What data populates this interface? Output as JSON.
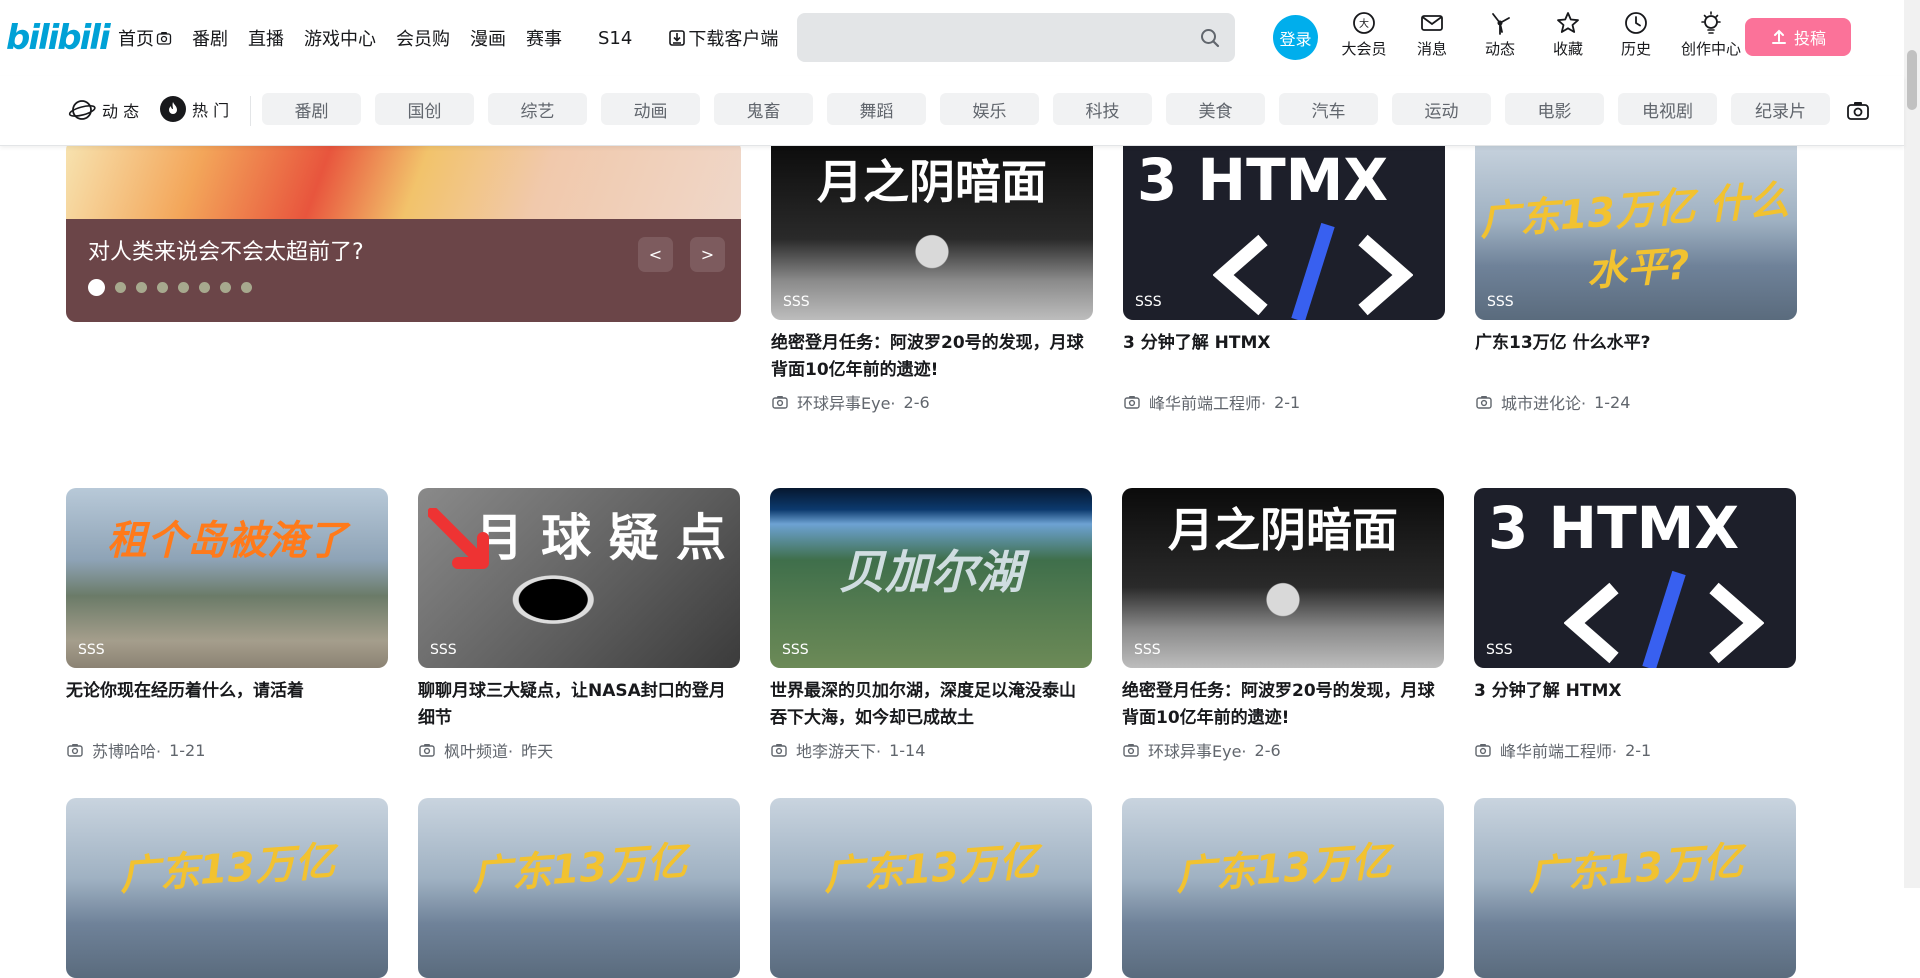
{
  "header": {
    "logo": "bilibili",
    "nav": [
      {
        "label": "首页",
        "icon": "camera-icon"
      },
      {
        "label": "番剧"
      },
      {
        "label": "直播"
      },
      {
        "label": "游戏中心"
      },
      {
        "label": "会员购"
      },
      {
        "label": "漫画"
      },
      {
        "label": "赛事"
      },
      {
        "label": "S14"
      }
    ],
    "download": "下载客户端",
    "search_placeholder": "",
    "login": "登录",
    "right_icons": [
      {
        "label": "大会员",
        "icon": "vip-icon"
      },
      {
        "label": "消息",
        "icon": "mail-icon"
      },
      {
        "label": "动态",
        "icon": "wind-icon"
      },
      {
        "label": "收藏",
        "icon": "star-icon"
      },
      {
        "label": "历史",
        "icon": "clock-icon"
      },
      {
        "label": "创作中心",
        "icon": "bulb-icon"
      }
    ],
    "upload": "投稿"
  },
  "channels": {
    "main": [
      {
        "label": "动 态",
        "icon": "planet-icon"
      },
      {
        "label": "热 门",
        "icon": "fire-icon"
      }
    ],
    "chips": [
      "番剧",
      "国创",
      "综艺",
      "动画",
      "鬼畜",
      "舞蹈",
      "娱乐",
      "科技",
      "美食",
      "汽车",
      "运动",
      "电影",
      "电视剧",
      "纪录片"
    ]
  },
  "carousel": {
    "title": "对人类来说会不会太超前了?",
    "prev": "<",
    "next": ">",
    "dots": 8,
    "active": 0
  },
  "cards": [
    {
      "thumb_text": "月之阴暗面",
      "tag": "SSS",
      "title": "绝密登月任务：阿波罗20号的发现，月球背面10亿年前的遗迹!",
      "author": "环球异事Eye",
      "date": "2-6",
      "art": "moon"
    },
    {
      "thumb_text": "3 HTMX",
      "tag": "SSS",
      "title": "3 分钟了解 HTMX",
      "author": "峰华前端工程师",
      "date": "2-1",
      "art": "htmx"
    },
    {
      "thumb_text": "广东13万亿 什么水平?",
      "tag": "SSS",
      "title": "广东13万亿 什么水平?",
      "author": "城市进化论",
      "date": "1-24",
      "art": "gd"
    },
    {
      "thumb_text": "租个岛被淹了",
      "tag": "SSS",
      "title": "无论你现在经历着什么，请活着",
      "author": "苏博哈哈",
      "date": "1-21",
      "art": "island"
    },
    {
      "thumb_text": "月 球 疑 点",
      "tag": "SSS",
      "title": "聊聊月球三大疑点，让NASA封口的登月细节",
      "author": "枫叶频道",
      "date": "昨天",
      "art": "lunar"
    },
    {
      "thumb_text": "贝加尔湖",
      "tag": "SSS",
      "title": "世界最深的贝加尔湖，深度足以淹没泰山吞下大海，如今却已成故土",
      "author": "地李游天下",
      "date": "1-14",
      "art": "baikal"
    },
    {
      "thumb_text": "月之阴暗面",
      "tag": "SSS",
      "title": "绝密登月任务：阿波罗20号的发现，月球背面10亿年前的遗迹!",
      "author": "环球异事Eye",
      "date": "2-6",
      "art": "moon"
    },
    {
      "thumb_text": "3 HTMX",
      "tag": "SSS",
      "title": "3 分钟了解 HTMX",
      "author": "峰华前端工程师",
      "date": "2-1",
      "art": "htmx"
    },
    {
      "thumb_text": "广东13万亿",
      "tag": "",
      "title": "",
      "author": "",
      "date": "",
      "art": "gd"
    },
    {
      "thumb_text": "广东13万亿",
      "tag": "",
      "title": "",
      "author": "",
      "date": "",
      "art": "gd"
    },
    {
      "thumb_text": "广东13万亿",
      "tag": "",
      "title": "",
      "author": "",
      "date": "",
      "art": "gd"
    },
    {
      "thumb_text": "广东13万亿",
      "tag": "",
      "title": "",
      "author": "",
      "date": "",
      "art": "gd"
    },
    {
      "thumb_text": "广东13万亿",
      "tag": "",
      "title": "",
      "author": "",
      "date": "",
      "art": "gd"
    }
  ],
  "colors": {
    "brand": "#00aeec",
    "upload": "#fb7299",
    "chip_bg": "#f1f2f3"
  }
}
